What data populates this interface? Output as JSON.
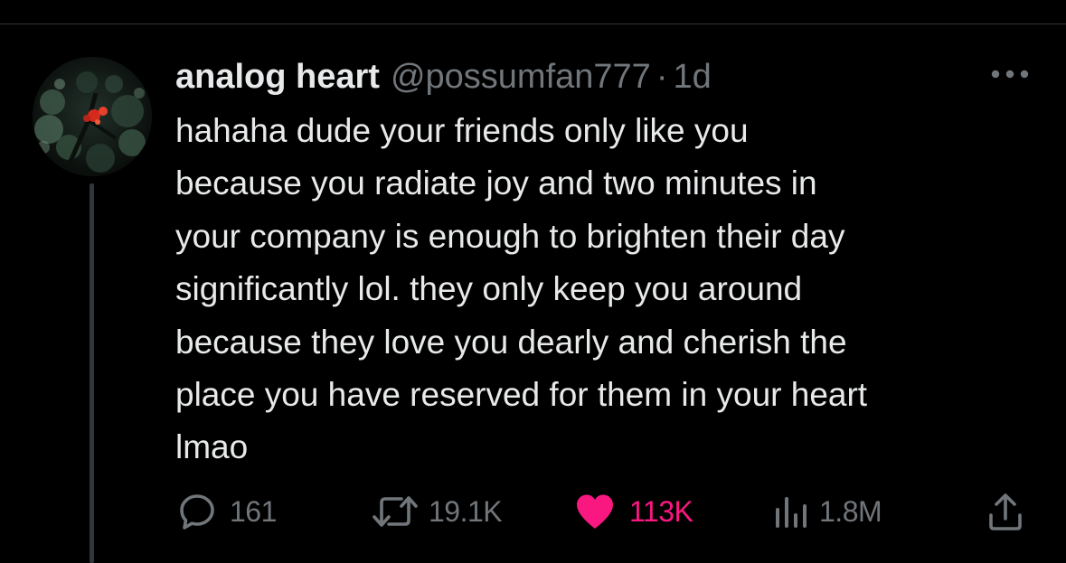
{
  "tweet": {
    "author": {
      "display_name": "analog heart",
      "handle": "@possumfan777"
    },
    "separator": "·",
    "time": "1d",
    "text": "hahaha dude your friends only like you\nbecause you radiate joy and two minutes in\nyour company is enough to brighten their day\nsignificantly lol. they only keep you around\nbecause they love you dearly and cherish the\nplace you have reserved for them in your heart\nlmao",
    "actions": {
      "replies": "161",
      "retweets": "19.1K",
      "likes": "113K",
      "views": "1.8M"
    }
  },
  "icons": {
    "more": "more-horizontal-icon",
    "reply": "reply-bubble-icon",
    "retweet": "retweet-icon",
    "like": "heart-icon",
    "views": "bar-chart-icon",
    "share": "share-icon"
  },
  "colors": {
    "background": "#000000",
    "text_primary": "#e7e9ea",
    "text_secondary": "#71767b",
    "like_active": "#f91880",
    "thread_line": "#333639"
  }
}
